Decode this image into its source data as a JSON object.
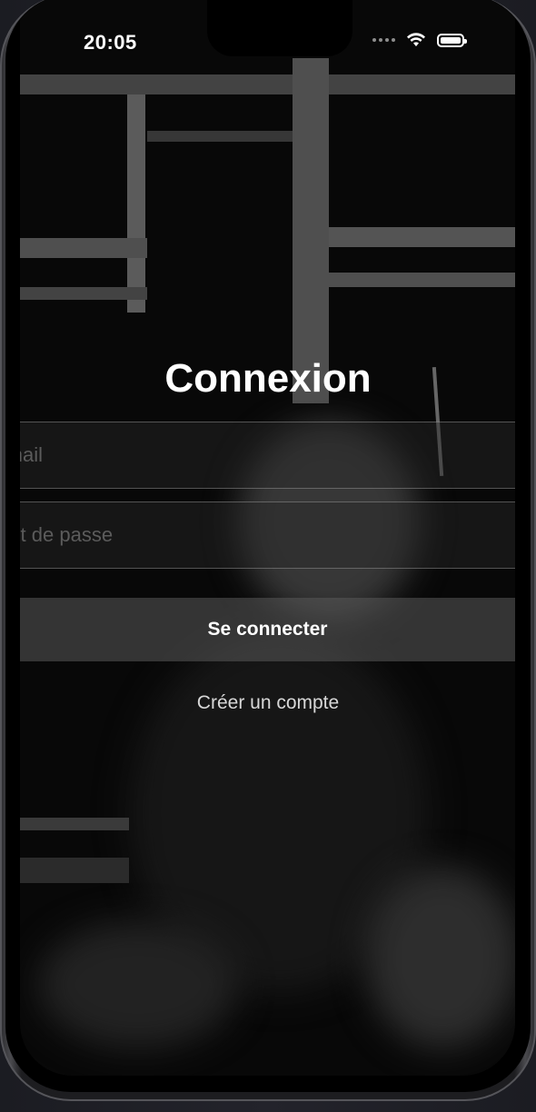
{
  "status_bar": {
    "time": "20:05",
    "wifi_icon": "wifi-icon",
    "battery_icon": "battery-icon"
  },
  "login": {
    "title": "Connexion",
    "email_placeholder": "Email",
    "password_placeholder": "Mot de passe",
    "submit_label": "Se connecter",
    "create_account_label": "Créer un compte"
  },
  "colors": {
    "text": "#ffffff",
    "button_bg": "#5a5a5a",
    "background": "#0b0b0b"
  }
}
